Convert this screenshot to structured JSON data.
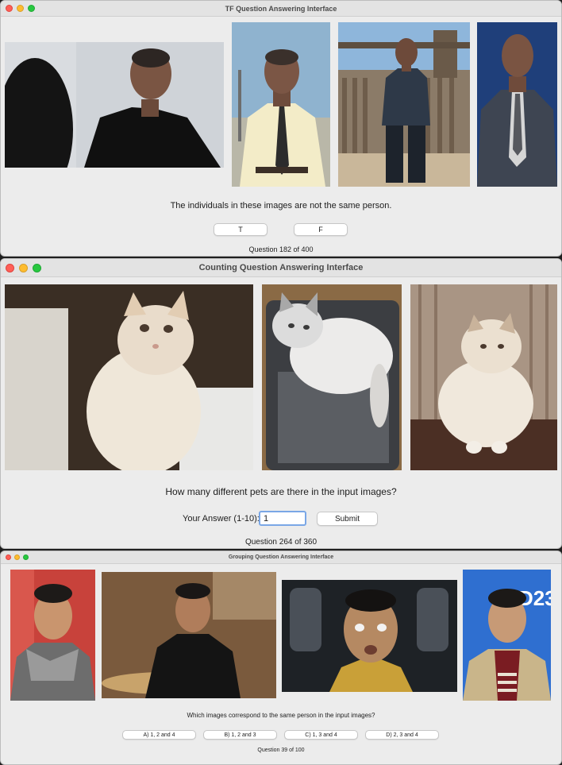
{
  "windows": {
    "tf": {
      "title": "TF Question Answering Interface",
      "question": "The individuals in these images are not the same person.",
      "buttons": {
        "true_label": "T",
        "false_label": "F"
      },
      "counter": "Question 182 of 400"
    },
    "counting": {
      "title": "Counting Question Answering Interface",
      "question": "How many different pets are there in the input images?",
      "answer_label": "Your Answer (1-10):",
      "answer_value": "1",
      "submit_label": "Submit",
      "counter": "Question 264 of 360"
    },
    "grouping": {
      "title": "Grouping Question Answering Interface",
      "question": "Which images correspond to the same person in the input images?",
      "options": [
        "A) 1, 2 and 4",
        "B) 1, 2 and 3",
        "C) 1, 3 and 4",
        "D) 2, 3 and 4"
      ],
      "counter": "Question 39 of 100"
    }
  },
  "icons": [
    "close-dot-icon",
    "minimize-dot-icon",
    "zoom-dot-icon"
  ],
  "colors": {
    "close": "#ff5f57",
    "minimize": "#febc2e",
    "zoom": "#28c840",
    "window_bg": "#ececec"
  }
}
